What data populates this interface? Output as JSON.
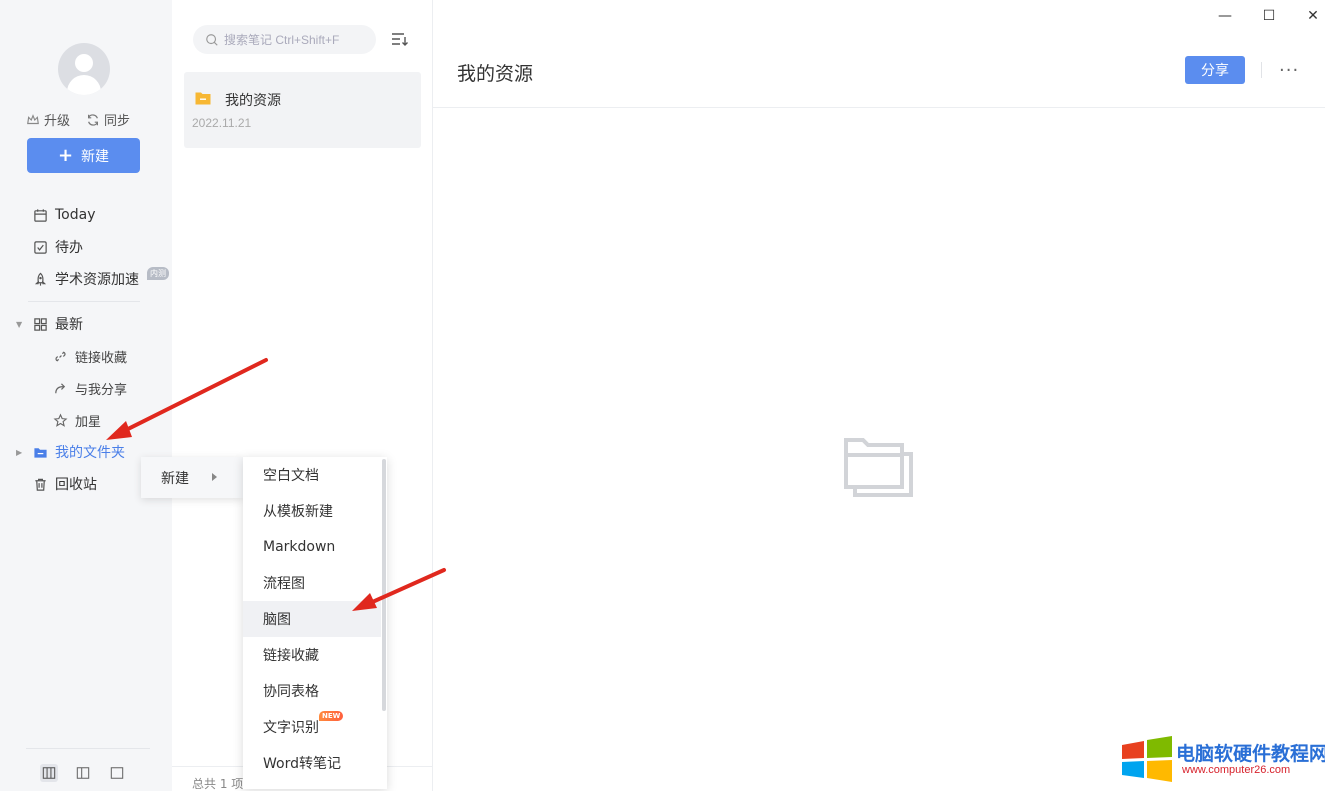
{
  "sidebar": {
    "upgrade_label": "升级",
    "sync_label": "同步",
    "new_label": "新建",
    "items": {
      "today": "Today",
      "todo": "待办",
      "academic": "学术资源加速",
      "academic_badge": "内测",
      "latest": "最新",
      "links": "链接收藏",
      "shared": "与我分享",
      "starred": "加星",
      "my_folder": "我的文件夹",
      "trash": "回收站"
    }
  },
  "notelist": {
    "search_placeholder": "搜索笔记 Ctrl+Shift+F",
    "note_title": "我的资源",
    "note_date": "2022.11.21",
    "footer": "总共 1 项"
  },
  "main": {
    "title": "我的资源",
    "share_label": "分享",
    "more_label": "···",
    "minimize": "—",
    "maximize": "☐",
    "close": "✕"
  },
  "context_menu": {
    "parent_label": "新建",
    "items": [
      "空白文档",
      "从模板新建",
      "Markdown",
      "流程图",
      "脑图",
      "链接收藏",
      "协同表格",
      "文字识别",
      "Word转笔记"
    ],
    "new_badge": "NEW",
    "hovered_item": "脑图"
  },
  "watermark": {
    "title": "电脑软硬件教程网",
    "url": "www.computer26.com"
  },
  "colors": {
    "accent": "#5b8def",
    "active_text": "#4a7fe8",
    "arrow": "#e0281e"
  }
}
